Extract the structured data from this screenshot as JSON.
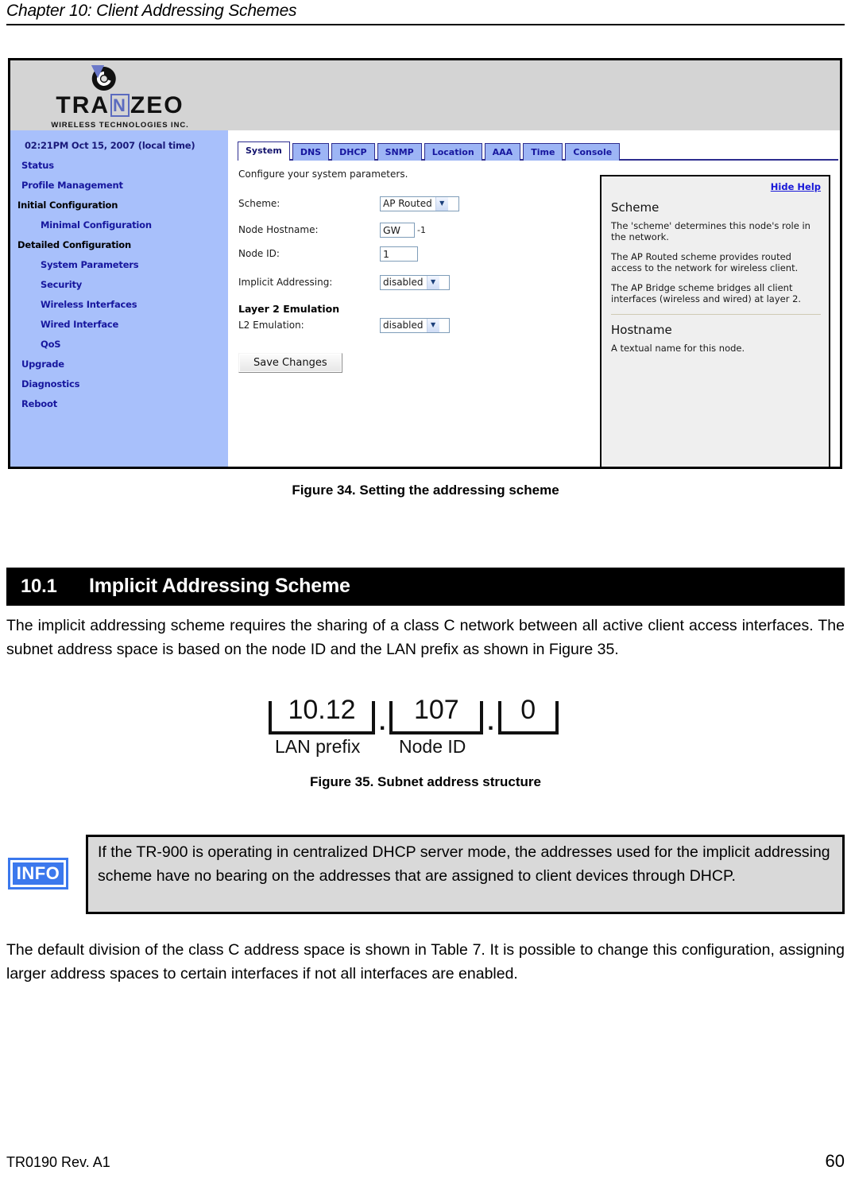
{
  "page": {
    "chapter_title": "Chapter 10: Client Addressing Schemes",
    "footer_left": "TR0190 Rev. A1",
    "footer_page_number": "60"
  },
  "figure34": {
    "caption": "Figure 34. Setting the addressing scheme",
    "logo": {
      "wordmark_part1": "TRA",
      "wordmark_boxed_letter": "N",
      "wordmark_part2": "ZEO",
      "tagline": "WIRELESS  TECHNOLOGIES INC."
    },
    "sidebar": {
      "clock": "02:21PM Oct 15, 2007 (local time)",
      "items": [
        {
          "label": "Status",
          "type": "link"
        },
        {
          "label": "Profile Management",
          "type": "link"
        },
        {
          "label": "Initial Configuration",
          "type": "heading"
        },
        {
          "label": "Minimal Configuration",
          "type": "sublink"
        },
        {
          "label": "Detailed Configuration",
          "type": "heading"
        },
        {
          "label": "System Parameters",
          "type": "sublink"
        },
        {
          "label": "Security",
          "type": "sublink"
        },
        {
          "label": "Wireless Interfaces",
          "type": "sublink"
        },
        {
          "label": "Wired Interface",
          "type": "sublink"
        },
        {
          "label": "QoS",
          "type": "sublink"
        },
        {
          "label": "Upgrade",
          "type": "link"
        },
        {
          "label": "Diagnostics",
          "type": "link"
        },
        {
          "label": "Reboot",
          "type": "link"
        }
      ]
    },
    "tabs": [
      {
        "label": "System",
        "active": true
      },
      {
        "label": "DNS",
        "active": false
      },
      {
        "label": "DHCP",
        "active": false
      },
      {
        "label": "SNMP",
        "active": false
      },
      {
        "label": "Location",
        "active": false
      },
      {
        "label": "AAA",
        "active": false
      },
      {
        "label": "Time",
        "active": false
      },
      {
        "label": "Console",
        "active": false
      }
    ],
    "form": {
      "intro": "Configure your system parameters.",
      "scheme_label": "Scheme:",
      "scheme_value": "AP Routed",
      "hostname_label": "Node Hostname:",
      "hostname_value": "GW",
      "hostname_suffix": "-1",
      "nodeid_label": "Node ID:",
      "nodeid_value": "1",
      "implicit_label": "Implicit Addressing:",
      "implicit_value": "disabled",
      "layer2_section": "Layer 2 Emulation",
      "l2_label": "L2 Emulation:",
      "l2_value": "disabled",
      "save_label": "Save Changes"
    },
    "help": {
      "hide_link": "Hide Help",
      "scheme_heading": "Scheme",
      "scheme_p1": "The 'scheme' determines this node's role in the network.",
      "scheme_p2": "The AP Routed scheme provides routed access to the network for wireless client.",
      "scheme_p3": "The AP Bridge scheme bridges all client interfaces (wireless and wired) at layer 2.",
      "hostname_heading": "Hostname",
      "hostname_p1": "A textual name for this node."
    }
  },
  "section": {
    "number": "10.1",
    "title": "Implicit Addressing Scheme"
  },
  "paragraphs": {
    "intro": "The implicit addressing scheme requires the sharing of a class C network between all active client access interfaces. The subnet address space is based on the node ID and the LAN prefix as shown in Figure 35.",
    "closing": "The default division of the class C address space is shown in Table 7. It is possible to change this configuration, assigning larger address spaces to certain interfaces if not all interfaces are enabled."
  },
  "figure35": {
    "caption": "Figure 35. Subnet address structure",
    "octet1": "10.12",
    "octet2": "107",
    "octet3": "0",
    "separator": ".",
    "label1": "LAN prefix",
    "label2": "Node ID"
  },
  "info_note": {
    "icon_label": "INFO",
    "text": "If the TR-900 is operating in centralized DHCP server mode, the addresses used for the implicit addressing scheme have no bearing on the addresses that are assigned to client devices through DHCP."
  },
  "colors": {
    "sidebar_bg": "#a8c0fb",
    "tab_bg": "#9db5f5",
    "tab_border": "#2d2d8f",
    "link_blue": "#17179e",
    "help_bg": "#efefef",
    "info_blue": "#3b78ed",
    "note_bg": "#d9d9d9"
  }
}
